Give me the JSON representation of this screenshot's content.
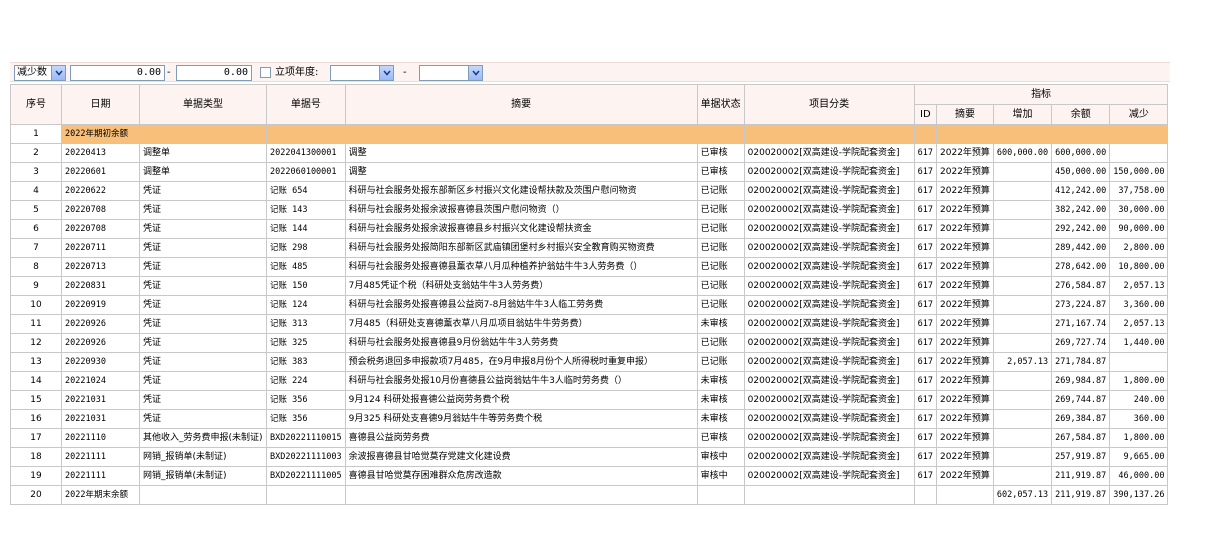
{
  "filter": {
    "field_select": "减少数",
    "min_value": "0.00",
    "range_sep": "-",
    "max_value": "0.00",
    "project_year_label": "立项年度:",
    "year_from": "",
    "year_sep": "-",
    "year_to": ""
  },
  "table": {
    "headers": {
      "seq": "序号",
      "date": "日期",
      "doc_type": "单据类型",
      "doc_no": "单据号",
      "summary": "摘要",
      "status": "单据状态",
      "project": "项目分类",
      "indicator": "指标",
      "ind_id": "ID",
      "ind_summary": "摘要",
      "ind_increase": "增加",
      "ind_balance": "余额",
      "ind_decrease": "减少"
    },
    "rows": [
      {
        "seq": "1",
        "date": "2022年期初余额",
        "type": "",
        "no": "",
        "summary": "",
        "status": "",
        "project": "",
        "id": "",
        "isum": "",
        "inc": "",
        "bal": "",
        "dec": ""
      },
      {
        "seq": "2",
        "date": "20220413",
        "type": "调整单",
        "no": "2022041300001",
        "summary": "调整",
        "status": "已审核",
        "project": "020020002[双高建设-学院配套资金]",
        "id": "617",
        "isum": "2022年预算",
        "inc": "600,000.00",
        "bal": "600,000.00",
        "dec": ""
      },
      {
        "seq": "3",
        "date": "20220601",
        "type": "调整单",
        "no": "2022060100001",
        "summary": "调整",
        "status": "已审核",
        "project": "020020002[双高建设-学院配套资金]",
        "id": "617",
        "isum": "2022年预算",
        "inc": "",
        "bal": "450,000.00",
        "dec": "150,000.00"
      },
      {
        "seq": "4",
        "date": "20220622",
        "type": "凭证",
        "no": "记账   654",
        "summary": "科研与社会服务处报东部新区乡村振兴文化建设帮扶款及茨围户慰问物资",
        "status": "已记账",
        "project": "020020002[双高建设-学院配套资金]",
        "id": "617",
        "isum": "2022年预算",
        "inc": "",
        "bal": "412,242.00",
        "dec": "37,758.00"
      },
      {
        "seq": "5",
        "date": "20220708",
        "type": "凭证",
        "no": "记账   143",
        "summary": "科研与社会服务处报余波报喜德县茨围户慰问物资（）",
        "status": "已记账",
        "project": "020020002[双高建设-学院配套资金]",
        "id": "617",
        "isum": "2022年预算",
        "inc": "",
        "bal": "382,242.00",
        "dec": "30,000.00"
      },
      {
        "seq": "6",
        "date": "20220708",
        "type": "凭证",
        "no": "记账   144",
        "summary": "科研与社会服务处报余波报喜德县乡村振兴文化建设帮扶资金",
        "status": "已记账",
        "project": "020020002[双高建设-学院配套资金]",
        "id": "617",
        "isum": "2022年预算",
        "inc": "",
        "bal": "292,242.00",
        "dec": "90,000.00"
      },
      {
        "seq": "7",
        "date": "20220711",
        "type": "凭证",
        "no": "记账   298",
        "summary": "科研与社会服务处报简阳东部新区武庙镇团堡村乡村振兴安全教育购买物资费",
        "status": "已记账",
        "project": "020020002[双高建设-学院配套资金]",
        "id": "617",
        "isum": "2022年预算",
        "inc": "",
        "bal": "289,442.00",
        "dec": "2,800.00"
      },
      {
        "seq": "8",
        "date": "20220713",
        "type": "凭证",
        "no": "记账   485",
        "summary": "科研与社会服务处报喜德县薰衣草八月瓜种植养护翁姑牛牛3人劳务费（）",
        "status": "已记账",
        "project": "020020002[双高建设-学院配套资金]",
        "id": "617",
        "isum": "2022年预算",
        "inc": "",
        "bal": "278,642.00",
        "dec": "10,800.00"
      },
      {
        "seq": "9",
        "date": "20220831",
        "type": "凭证",
        "no": "记账   150",
        "summary": "7月485凭证个税（科研处支翁姑牛牛3人劳务费）",
        "status": "已记账",
        "project": "020020002[双高建设-学院配套资金]",
        "id": "617",
        "isum": "2022年预算",
        "inc": "",
        "bal": "276,584.87",
        "dec": "2,057.13"
      },
      {
        "seq": "10",
        "date": "20220919",
        "type": "凭证",
        "no": "记账   124",
        "summary": "科研与社会服务处报喜德县公益岗7-8月翁姑牛牛3人临工劳务费",
        "status": "已记账",
        "project": "020020002[双高建设-学院配套资金]",
        "id": "617",
        "isum": "2022年预算",
        "inc": "",
        "bal": "273,224.87",
        "dec": "3,360.00"
      },
      {
        "seq": "11",
        "date": "20220926",
        "type": "凭证",
        "no": "记账   313",
        "summary": "7月485（科研处支喜德薰衣草八月瓜项目翁姑牛牛劳务费）",
        "status": "未审核",
        "project": "020020002[双高建设-学院配套资金]",
        "id": "617",
        "isum": "2022年预算",
        "inc": "",
        "bal": "271,167.74",
        "dec": "2,057.13"
      },
      {
        "seq": "12",
        "date": "20220926",
        "type": "凭证",
        "no": "记账   325",
        "summary": "科研与社会服务处报喜德县9月份翁姑牛牛3人劳务费",
        "status": "已记账",
        "project": "020020002[双高建设-学院配套资金]",
        "id": "617",
        "isum": "2022年预算",
        "inc": "",
        "bal": "269,727.74",
        "dec": "1,440.00"
      },
      {
        "seq": "13",
        "date": "20220930",
        "type": "凭证",
        "no": "记账   383",
        "summary": "预会税务退回多申报款项7月485，在9月申报8月份个人所得税时重复申报）",
        "status": "已记账",
        "project": "020020002[双高建设-学院配套资金]",
        "id": "617",
        "isum": "2022年预算",
        "inc": "2,057.13",
        "bal": "271,784.87",
        "dec": ""
      },
      {
        "seq": "14",
        "date": "20221024",
        "type": "凭证",
        "no": "记账   224",
        "summary": "科研与社会服务处报10月份喜德县公益岗翁姑牛牛3人临时劳务费（）",
        "status": "未审核",
        "project": "020020002[双高建设-学院配套资金]",
        "id": "617",
        "isum": "2022年预算",
        "inc": "",
        "bal": "269,984.87",
        "dec": "1,800.00"
      },
      {
        "seq": "15",
        "date": "20221031",
        "type": "凭证",
        "no": "记账   356",
        "summary": "9月124 科研处报喜德公益岗劳务费个税",
        "status": "未审核",
        "project": "020020002[双高建设-学院配套资金]",
        "id": "617",
        "isum": "2022年预算",
        "inc": "",
        "bal": "269,744.87",
        "dec": "240.00"
      },
      {
        "seq": "16",
        "date": "20221031",
        "type": "凭证",
        "no": "记账   356",
        "summary": "9月325 科研处支喜德9月翁姑牛牛等劳务费个税",
        "status": "未审核",
        "project": "020020002[双高建设-学院配套资金]",
        "id": "617",
        "isum": "2022年预算",
        "inc": "",
        "bal": "269,384.87",
        "dec": "360.00"
      },
      {
        "seq": "17",
        "date": "20221110",
        "type": "其他收入_劳务费申报(未制证)",
        "no": "BXD20221110015",
        "summary": "喜德县公益岗劳务费",
        "status": "已审核",
        "project": "020020002[双高建设-学院配套资金]",
        "id": "617",
        "isum": "2022年预算",
        "inc": "",
        "bal": "267,584.87",
        "dec": "1,800.00"
      },
      {
        "seq": "18",
        "date": "20221111",
        "type": "网销_报销单(未制证)",
        "no": "BXD20221111003",
        "summary": "余波报喜德县甘哈觉莫存党建文化建设费",
        "status": "审核中",
        "project": "020020002[双高建设-学院配套资金]",
        "id": "617",
        "isum": "2022年预算",
        "inc": "",
        "bal": "257,919.87",
        "dec": "9,665.00"
      },
      {
        "seq": "19",
        "date": "20221111",
        "type": "网销_报销单(未制证)",
        "no": "BXD20221111005",
        "summary": "喜德县甘哈觉莫存困难群众危房改造款",
        "status": "审核中",
        "project": "020020002[双高建设-学院配套资金]",
        "id": "617",
        "isum": "2022年预算",
        "inc": "",
        "bal": "211,919.87",
        "dec": "46,000.00"
      },
      {
        "seq": "20",
        "date": "2022年期末余额",
        "type": "",
        "no": "",
        "summary": "",
        "status": "",
        "project": "",
        "id": "",
        "isum": "",
        "inc": "602,057.13",
        "bal": "211,919.87",
        "dec": "390,137.26"
      }
    ]
  }
}
